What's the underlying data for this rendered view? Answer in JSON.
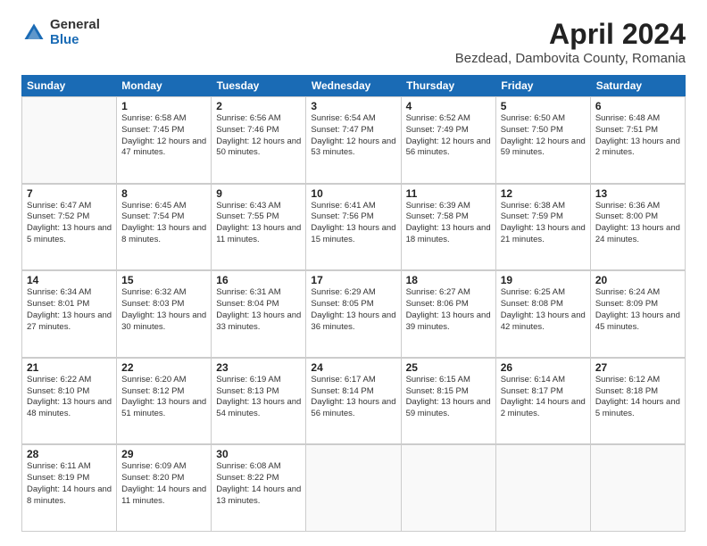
{
  "logo": {
    "general": "General",
    "blue": "Blue"
  },
  "title": "April 2024",
  "subtitle": "Bezdead, Dambovita County, Romania",
  "headers": [
    "Sunday",
    "Monday",
    "Tuesday",
    "Wednesday",
    "Thursday",
    "Friday",
    "Saturday"
  ],
  "weeks": [
    [
      {
        "day": "",
        "sunrise": "",
        "sunset": "",
        "daylight": "",
        "empty": true
      },
      {
        "day": "1",
        "sunrise": "Sunrise: 6:58 AM",
        "sunset": "Sunset: 7:45 PM",
        "daylight": "Daylight: 12 hours and 47 minutes."
      },
      {
        "day": "2",
        "sunrise": "Sunrise: 6:56 AM",
        "sunset": "Sunset: 7:46 PM",
        "daylight": "Daylight: 12 hours and 50 minutes."
      },
      {
        "day": "3",
        "sunrise": "Sunrise: 6:54 AM",
        "sunset": "Sunset: 7:47 PM",
        "daylight": "Daylight: 12 hours and 53 minutes."
      },
      {
        "day": "4",
        "sunrise": "Sunrise: 6:52 AM",
        "sunset": "Sunset: 7:49 PM",
        "daylight": "Daylight: 12 hours and 56 minutes."
      },
      {
        "day": "5",
        "sunrise": "Sunrise: 6:50 AM",
        "sunset": "Sunset: 7:50 PM",
        "daylight": "Daylight: 12 hours and 59 minutes."
      },
      {
        "day": "6",
        "sunrise": "Sunrise: 6:48 AM",
        "sunset": "Sunset: 7:51 PM",
        "daylight": "Daylight: 13 hours and 2 minutes."
      }
    ],
    [
      {
        "day": "7",
        "sunrise": "Sunrise: 6:47 AM",
        "sunset": "Sunset: 7:52 PM",
        "daylight": "Daylight: 13 hours and 5 minutes."
      },
      {
        "day": "8",
        "sunrise": "Sunrise: 6:45 AM",
        "sunset": "Sunset: 7:54 PM",
        "daylight": "Daylight: 13 hours and 8 minutes."
      },
      {
        "day": "9",
        "sunrise": "Sunrise: 6:43 AM",
        "sunset": "Sunset: 7:55 PM",
        "daylight": "Daylight: 13 hours and 11 minutes."
      },
      {
        "day": "10",
        "sunrise": "Sunrise: 6:41 AM",
        "sunset": "Sunset: 7:56 PM",
        "daylight": "Daylight: 13 hours and 15 minutes."
      },
      {
        "day": "11",
        "sunrise": "Sunrise: 6:39 AM",
        "sunset": "Sunset: 7:58 PM",
        "daylight": "Daylight: 13 hours and 18 minutes."
      },
      {
        "day": "12",
        "sunrise": "Sunrise: 6:38 AM",
        "sunset": "Sunset: 7:59 PM",
        "daylight": "Daylight: 13 hours and 21 minutes."
      },
      {
        "day": "13",
        "sunrise": "Sunrise: 6:36 AM",
        "sunset": "Sunset: 8:00 PM",
        "daylight": "Daylight: 13 hours and 24 minutes."
      }
    ],
    [
      {
        "day": "14",
        "sunrise": "Sunrise: 6:34 AM",
        "sunset": "Sunset: 8:01 PM",
        "daylight": "Daylight: 13 hours and 27 minutes."
      },
      {
        "day": "15",
        "sunrise": "Sunrise: 6:32 AM",
        "sunset": "Sunset: 8:03 PM",
        "daylight": "Daylight: 13 hours and 30 minutes."
      },
      {
        "day": "16",
        "sunrise": "Sunrise: 6:31 AM",
        "sunset": "Sunset: 8:04 PM",
        "daylight": "Daylight: 13 hours and 33 minutes."
      },
      {
        "day": "17",
        "sunrise": "Sunrise: 6:29 AM",
        "sunset": "Sunset: 8:05 PM",
        "daylight": "Daylight: 13 hours and 36 minutes."
      },
      {
        "day": "18",
        "sunrise": "Sunrise: 6:27 AM",
        "sunset": "Sunset: 8:06 PM",
        "daylight": "Daylight: 13 hours and 39 minutes."
      },
      {
        "day": "19",
        "sunrise": "Sunrise: 6:25 AM",
        "sunset": "Sunset: 8:08 PM",
        "daylight": "Daylight: 13 hours and 42 minutes."
      },
      {
        "day": "20",
        "sunrise": "Sunrise: 6:24 AM",
        "sunset": "Sunset: 8:09 PM",
        "daylight": "Daylight: 13 hours and 45 minutes."
      }
    ],
    [
      {
        "day": "21",
        "sunrise": "Sunrise: 6:22 AM",
        "sunset": "Sunset: 8:10 PM",
        "daylight": "Daylight: 13 hours and 48 minutes."
      },
      {
        "day": "22",
        "sunrise": "Sunrise: 6:20 AM",
        "sunset": "Sunset: 8:12 PM",
        "daylight": "Daylight: 13 hours and 51 minutes."
      },
      {
        "day": "23",
        "sunrise": "Sunrise: 6:19 AM",
        "sunset": "Sunset: 8:13 PM",
        "daylight": "Daylight: 13 hours and 54 minutes."
      },
      {
        "day": "24",
        "sunrise": "Sunrise: 6:17 AM",
        "sunset": "Sunset: 8:14 PM",
        "daylight": "Daylight: 13 hours and 56 minutes."
      },
      {
        "day": "25",
        "sunrise": "Sunrise: 6:15 AM",
        "sunset": "Sunset: 8:15 PM",
        "daylight": "Daylight: 13 hours and 59 minutes."
      },
      {
        "day": "26",
        "sunrise": "Sunrise: 6:14 AM",
        "sunset": "Sunset: 8:17 PM",
        "daylight": "Daylight: 14 hours and 2 minutes."
      },
      {
        "day": "27",
        "sunrise": "Sunrise: 6:12 AM",
        "sunset": "Sunset: 8:18 PM",
        "daylight": "Daylight: 14 hours and 5 minutes."
      }
    ],
    [
      {
        "day": "28",
        "sunrise": "Sunrise: 6:11 AM",
        "sunset": "Sunset: 8:19 PM",
        "daylight": "Daylight: 14 hours and 8 minutes."
      },
      {
        "day": "29",
        "sunrise": "Sunrise: 6:09 AM",
        "sunset": "Sunset: 8:20 PM",
        "daylight": "Daylight: 14 hours and 11 minutes."
      },
      {
        "day": "30",
        "sunrise": "Sunrise: 6:08 AM",
        "sunset": "Sunset: 8:22 PM",
        "daylight": "Daylight: 14 hours and 13 minutes."
      },
      {
        "day": "",
        "sunrise": "",
        "sunset": "",
        "daylight": "",
        "empty": true
      },
      {
        "day": "",
        "sunrise": "",
        "sunset": "",
        "daylight": "",
        "empty": true
      },
      {
        "day": "",
        "sunrise": "",
        "sunset": "",
        "daylight": "",
        "empty": true
      },
      {
        "day": "",
        "sunrise": "",
        "sunset": "",
        "daylight": "",
        "empty": true
      }
    ]
  ]
}
